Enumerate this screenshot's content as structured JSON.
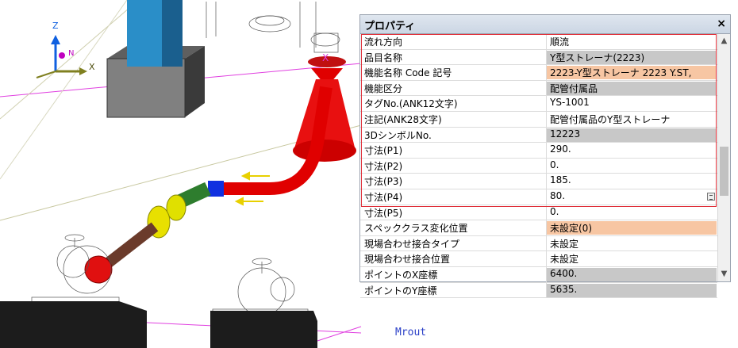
{
  "panel": {
    "title": "プロパティ",
    "close_glyph": "×"
  },
  "axes": {
    "x": "X",
    "y": "N",
    "z": "Z"
  },
  "status_text": "Mrout",
  "properties": [
    {
      "label": "流れ方向",
      "value": "順流",
      "style": "plain"
    },
    {
      "label": "品目名称",
      "value": "Y型ストレーナ(2223)",
      "style": "gray"
    },
    {
      "label": "機能名称 Code 記号",
      "value": "2223-Y型ストレーナ 2223 Y.ST,",
      "style": "orange"
    },
    {
      "label": "機能区分",
      "value": "配管付属品",
      "style": "gray"
    },
    {
      "label": "タグNo.(ANK12文字)",
      "value": "YS-1001",
      "style": "plain"
    },
    {
      "label": "注記(ANK28文字)",
      "value": "配管付属品のY型ストレーナ",
      "style": "plain"
    },
    {
      "label": "3DシンボルNo.",
      "value": "12223",
      "style": "gray"
    },
    {
      "label": "寸法(P1)",
      "value": "290.",
      "style": "plain"
    },
    {
      "label": "寸法(P2)",
      "value": "0.",
      "style": "plain"
    },
    {
      "label": "寸法(P3)",
      "value": "185.",
      "style": "plain"
    },
    {
      "label": "寸法(P4)",
      "value": "80.",
      "style": "plain",
      "edit": true
    },
    {
      "label": "寸法(P5)",
      "value": "0.",
      "style": "plain"
    },
    {
      "label": "スペッククラス変化位置",
      "value": "未設定(0)",
      "style": "orange"
    },
    {
      "label": "現場合わせ接合タイプ",
      "value": "未設定",
      "style": "plain"
    },
    {
      "label": "現場合わせ接合位置",
      "value": "未設定",
      "style": "plain"
    },
    {
      "label": "ポイントのX座標",
      "value": "6400.",
      "style": "gray"
    },
    {
      "label": "ポイントのY座標",
      "value": "5635.",
      "style": "gray"
    }
  ],
  "icons": {
    "close": "close-icon",
    "scroll_up": "chevron-up-icon",
    "scroll_down": "chevron-down-icon",
    "edit": "ellipsis-edit-icon"
  }
}
